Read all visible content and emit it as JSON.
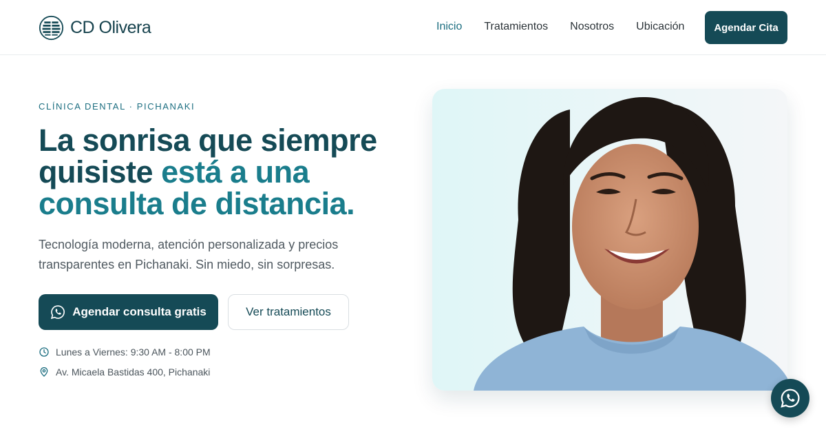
{
  "header": {
    "brand": "CD Olivera",
    "nav": [
      "Inicio",
      "Tratamientos",
      "Nosotros",
      "Ubicación"
    ],
    "active_nav": "Inicio",
    "cta": "Agendar Cita"
  },
  "hero": {
    "eyebrow": "CLÍNICA DENTAL · PICHANAKI",
    "headline_part1": "La sonrisa que siempre quisiste",
    "headline_part2": "está a una consulta de distancia.",
    "subtitle": "Tecnología moderna, atención personalizada y precios transparentes en Pichanaki. Sin miedo, sin sorpresas.",
    "primary_button": "Agendar consulta gratis",
    "secondary_button": "Ver tratamientos",
    "hours": "Lunes a Viernes: 9:30 AM - 8:00 PM",
    "address": "Av. Micaela Bastidas 400, Pichanaki"
  },
  "icons": {
    "logo": "clinic-logo-icon",
    "whatsapp": "whatsapp-icon",
    "clock": "clock-icon",
    "pin": "location-pin-icon"
  },
  "colors": {
    "primary": "#154a56",
    "accent": "#1a7d8c",
    "eyebrow": "#1c6e80"
  }
}
